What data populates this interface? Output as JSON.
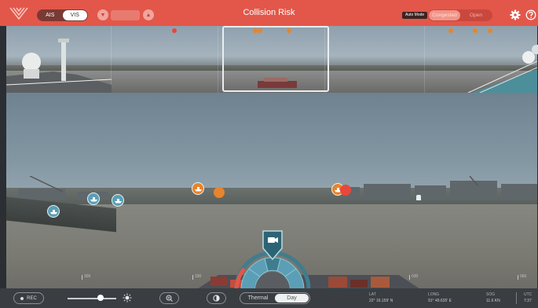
{
  "header": {
    "title": "Collision Risk",
    "sensor_toggle": {
      "options": [
        "AIS",
        "VIS"
      ],
      "selected": "VIS"
    },
    "auto_mode_label": "Auto Mode",
    "mode_toggle": {
      "options": [
        "Congested",
        "Open"
      ],
      "selected": "Congested"
    },
    "icons": {
      "logo": "app-logo-icon",
      "range_down": "triangle-down-icon",
      "range_up": "triangle-up-icon",
      "settings": "gear-icon",
      "help": "help-icon"
    }
  },
  "panorama": {
    "markers": [
      {
        "color": "#e8473b"
      },
      {
        "color": "#e8842b"
      },
      {
        "color": "#e8842b"
      },
      {
        "color": "#e8842b"
      },
      {
        "color": "#e8842b"
      },
      {
        "color": "#e8842b"
      },
      {
        "color": "#e8842b"
      }
    ]
  },
  "main_view": {
    "targets": [
      {
        "kind": "ship",
        "color": "#5b9fb6"
      },
      {
        "kind": "ship",
        "color": "#5b9fb6"
      },
      {
        "kind": "ship",
        "color": "#5b9fb6"
      },
      {
        "kind": "ship",
        "color": "#e8842b"
      },
      {
        "kind": "plain",
        "color": "#e8842b"
      },
      {
        "kind": "ship",
        "color": "#e8842b"
      },
      {
        "kind": "plain",
        "color": "#e8473b"
      }
    ],
    "bearing_ticks": [
      "300",
      "330",
      "030",
      "060"
    ],
    "camera_control": {
      "icon": "camera-icon"
    }
  },
  "bottom_bar": {
    "rec_label": "REC",
    "brightness_icon": "sun-icon",
    "zoom_icon": "zoom-in-icon",
    "contrast_icon": "contrast-icon",
    "view_toggle": {
      "options": [
        "Thermal",
        "Day"
      ],
      "selected": "Day"
    },
    "readouts": {
      "lat": {
        "label": "LAT",
        "value": "22° 16.159' N"
      },
      "long": {
        "label": "LONG",
        "value": "91° 49.635' E"
      },
      "sog": {
        "label": "SOG",
        "value": "11.6 KN"
      },
      "utc": {
        "label": "UTC",
        "value": "7:37"
      }
    }
  }
}
